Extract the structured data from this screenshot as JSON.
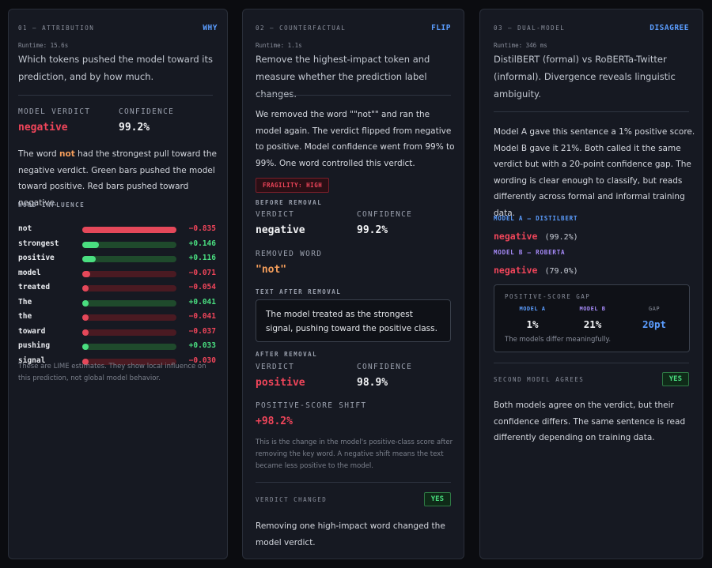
{
  "attribution": {
    "section": "01 — ATTRIBUTION",
    "tag": "WHY",
    "runtime": "Runtime: 15.6s",
    "description": "Which tokens pushed the model toward its prediction, and by how much.",
    "verdict_label": "MODEL VERDICT",
    "verdict_value": "negative",
    "confidence_label": "CONFIDENCE",
    "confidence_value": "99.2%",
    "explanation_pre": "The word ",
    "explanation_word": "not",
    "explanation_post": " had the strongest pull toward the negative verdict. Green bars pushed the model toward positive. Red bars pushed toward negative.",
    "influence_label": "WORD INFLUENCE",
    "words": [
      {
        "word": "not",
        "display": "−0.835",
        "value": -0.835
      },
      {
        "word": "strongest",
        "display": "+0.146",
        "value": 0.146
      },
      {
        "word": "positive",
        "display": "+0.116",
        "value": 0.116
      },
      {
        "word": "model",
        "display": "−0.071",
        "value": -0.071
      },
      {
        "word": "treated",
        "display": "−0.054",
        "value": -0.054
      },
      {
        "word": "The",
        "display": "+0.041",
        "value": 0.041
      },
      {
        "word": "the",
        "display": "−0.041",
        "value": -0.041
      },
      {
        "word": "toward",
        "display": "−0.037",
        "value": -0.037
      },
      {
        "word": "pushing",
        "display": "+0.033",
        "value": 0.033
      },
      {
        "word": "signal",
        "display": "−0.030",
        "value": -0.03
      }
    ],
    "note": "These are LIME estimates. They show local influence on this prediction, not global model behavior."
  },
  "counterfactual": {
    "section": "02 — COUNTERFACTUAL",
    "tag": "FLIP",
    "runtime": "Runtime: 1.1s",
    "description": "Remove the highest-impact token and measure whether the prediction label changes.",
    "explanation": "We removed the word \"\"not\"\" and ran the model again. The verdict flipped from negative to positive. Model confidence went from 99% to 99%. One word controlled this verdict.",
    "fragility": "FRAGILITY: HIGH",
    "before_label": "BEFORE REMOVAL",
    "verdict_label": "VERDICT",
    "confidence_label": "CONFIDENCE",
    "before_verdict": "negative",
    "before_confidence": "99.2%",
    "removed_label": "REMOVED WORD",
    "removed_word": "\"not\"",
    "text_after_label": "TEXT AFTER REMOVAL",
    "text_after": "The model treated as the strongest signal, pushing toward the positive class.",
    "after_label": "AFTER REMOVAL",
    "after_verdict": "positive",
    "after_confidence": "98.9%",
    "shift_label": "POSITIVE-SCORE SHIFT",
    "shift_value": "+98.2%",
    "shift_note": "This is the change in the model's positive-class score after removing the key word. A negative shift means the text became less positive to the model.",
    "changed_label": "VERDICT CHANGED",
    "changed_badge": "YES",
    "changed_text": "Removing one high-impact word changed the model verdict."
  },
  "dual_model": {
    "section": "03 — DUAL-MODEL",
    "tag": "DISAGREE",
    "runtime": "Runtime: 346 ms",
    "description": "DistilBERT (formal) vs RoBERTa-Twitter (informal). Divergence reveals linguistic ambiguity.",
    "explanation": "Model A gave this sentence a 1% positive score. Model B gave it 21%. Both called it the same verdict but with a 20-point confidence gap. The wording is clear enough to classify, but reads differently across formal and informal training data.",
    "model_a_label": "MODEL A — DISTILBERT",
    "model_a_verdict": "negative",
    "model_a_conf": "(99.2%)",
    "model_b_label": "MODEL B — ROBERTA",
    "model_b_verdict": "negative",
    "model_b_conf": "(79.0%)",
    "gap_label": "POSITIVE-SCORE GAP",
    "gap_a_label": "MODEL A",
    "gap_a_value": "1%",
    "gap_b_label": "MODEL B",
    "gap_b_value": "21%",
    "gap_label_short": "GAP",
    "gap_value": "20pt",
    "gap_note": "The models differ meaningfully.",
    "agree_label": "SECOND MODEL AGREES",
    "agree_badge": "YES",
    "agree_text": "Both models agree on the verdict, but their confidence differs. The same sentence is read differently depending on training data."
  },
  "colors": {
    "accent_blue": "#5b9dff",
    "negative_red": "#f0455a",
    "positive_green": "#4ade80",
    "removed_orange": "#f59e5b",
    "model_a_blue": "#5b9dff",
    "model_b_purple": "#a78bfa"
  }
}
